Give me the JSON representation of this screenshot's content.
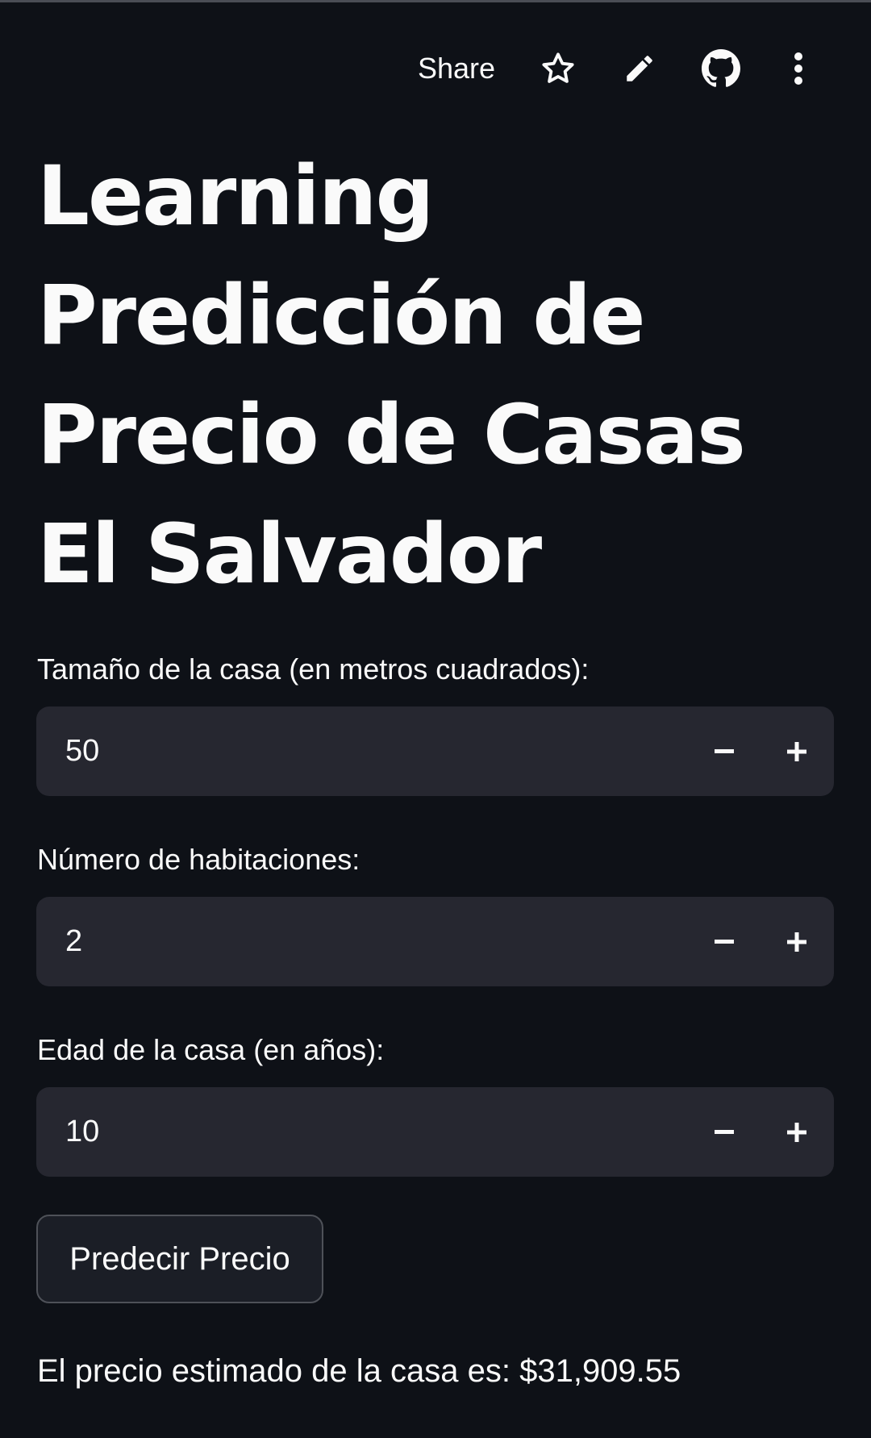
{
  "header": {
    "share_label": "Share",
    "icons": [
      "star-icon",
      "pencil-icon",
      "github-icon",
      "more-vertical-icon"
    ]
  },
  "title": "Learning Predicción de Precio de Casas El Salvador",
  "fields": [
    {
      "label": "Tamaño de la casa (en metros cuadrados):",
      "value": "50"
    },
    {
      "label": "Número de habitaciones:",
      "value": "2"
    },
    {
      "label": "Edad de la casa (en años):",
      "value": "10"
    }
  ],
  "stepper": {
    "minus": "−",
    "plus": "+"
  },
  "button_label": "Predecir Precio",
  "result_text": "El precio estimado de la casa es: $31,909.55",
  "colors": {
    "background": "#0e1117",
    "input_background": "#262730",
    "text": "#fafafa"
  }
}
